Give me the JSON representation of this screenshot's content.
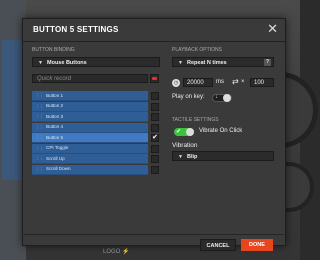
{
  "modal": {
    "title": "BUTTON 5 SETTINGS"
  },
  "binding": {
    "label": "BUTTON BINDING",
    "type_value": "Mouse Buttons",
    "search_placeholder": "Quick record",
    "items": [
      {
        "label": "Button 1",
        "checked": false
      },
      {
        "label": "Button 2",
        "checked": false
      },
      {
        "label": "Button 3",
        "checked": false
      },
      {
        "label": "Button 4",
        "checked": false
      },
      {
        "label": "Button 5",
        "checked": true,
        "mark": "✔"
      },
      {
        "label": "CPI Toggle",
        "checked": false
      },
      {
        "label": "Scroll Up",
        "checked": false
      },
      {
        "label": "Scroll Down",
        "checked": false
      }
    ]
  },
  "playback": {
    "label": "PLAYBACK OPTIONS",
    "mode_value": "Repeat N times",
    "help": "?",
    "delay_value": "20000",
    "delay_unit": "ms",
    "repeat_value": "100",
    "play_on_key_label": "Play on key:"
  },
  "tactile": {
    "label": "TACTILE SETTINGS",
    "vibrate_label": "Vibrate On Click",
    "vibrate_on": true,
    "vibration_label": "Vibration",
    "vibration_value": "Blip"
  },
  "footer": {
    "cancel_label": "CANCEL",
    "done_label": "DONE"
  },
  "background": {
    "logo_left": "LOGO",
    "logo_right": "⚡"
  },
  "colors": {
    "accent": "#e8451f",
    "list_blue": "#2f5e97",
    "toggle_green": "#3cc23c"
  }
}
